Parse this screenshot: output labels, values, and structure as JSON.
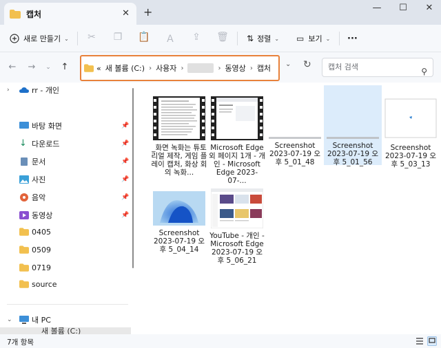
{
  "window": {
    "tab_title": "캡처",
    "new_tab": "+",
    "close_tab": "✕",
    "minimize": "—",
    "maximize": "☐",
    "close": "✕"
  },
  "toolbar": {
    "new_label": "새로 만들기",
    "sort_label": "정렬",
    "view_label": "보기",
    "more": "···"
  },
  "address": {
    "prefix": "«",
    "segments": [
      "새 볼륨 (C:)",
      "사용자",
      "",
      "동영상",
      "캡처"
    ]
  },
  "search": {
    "placeholder": "캡처 검색"
  },
  "sidebar": {
    "cloud": "rr - 개인",
    "quick": [
      {
        "label": "바탕 화면",
        "icon": "desktop-icon"
      },
      {
        "label": "다운로드",
        "icon": "download-icon"
      },
      {
        "label": "문서",
        "icon": "document-icon"
      },
      {
        "label": "사진",
        "icon": "picture-icon"
      },
      {
        "label": "음악",
        "icon": "music-icon"
      },
      {
        "label": "동영상",
        "icon": "video-icon"
      }
    ],
    "folders": [
      "0405",
      "0509",
      "0719",
      "source"
    ],
    "this_pc": "내 PC",
    "partial": "새 볼륨 (C:)"
  },
  "files": [
    {
      "name": "_화면 녹화는 튜토리얼 제작, 게임 플레이 캡처, 화상 회의 녹화...",
      "kind": "video"
    },
    {
      "name": "Microsoft Edge 외 페이지 1개 - 개인 - Microsoft Edge 2023-07-...",
      "kind": "video"
    },
    {
      "name": "Screenshot 2023-07-19 오후 5_01_48",
      "kind": "blank"
    },
    {
      "name": "Screenshot 2023-07-19 오후 5_01_56",
      "kind": "blank",
      "selected": true
    },
    {
      "name": "Screenshot 2023-07-19 오후 5_03_13",
      "kind": "dot"
    },
    {
      "name": "Screenshot 2023-07-19 오후 5_04_14",
      "kind": "win11"
    },
    {
      "name": "YouTube - 개인 - Microsoft Edge 2023-07-19 오후 5_06_21",
      "kind": "youtube"
    }
  ],
  "status": {
    "count": "7개 항목"
  },
  "colors": {
    "accent_outline": "#e8813a",
    "selection": "#dcecfb",
    "folder": "#f2c04f"
  }
}
